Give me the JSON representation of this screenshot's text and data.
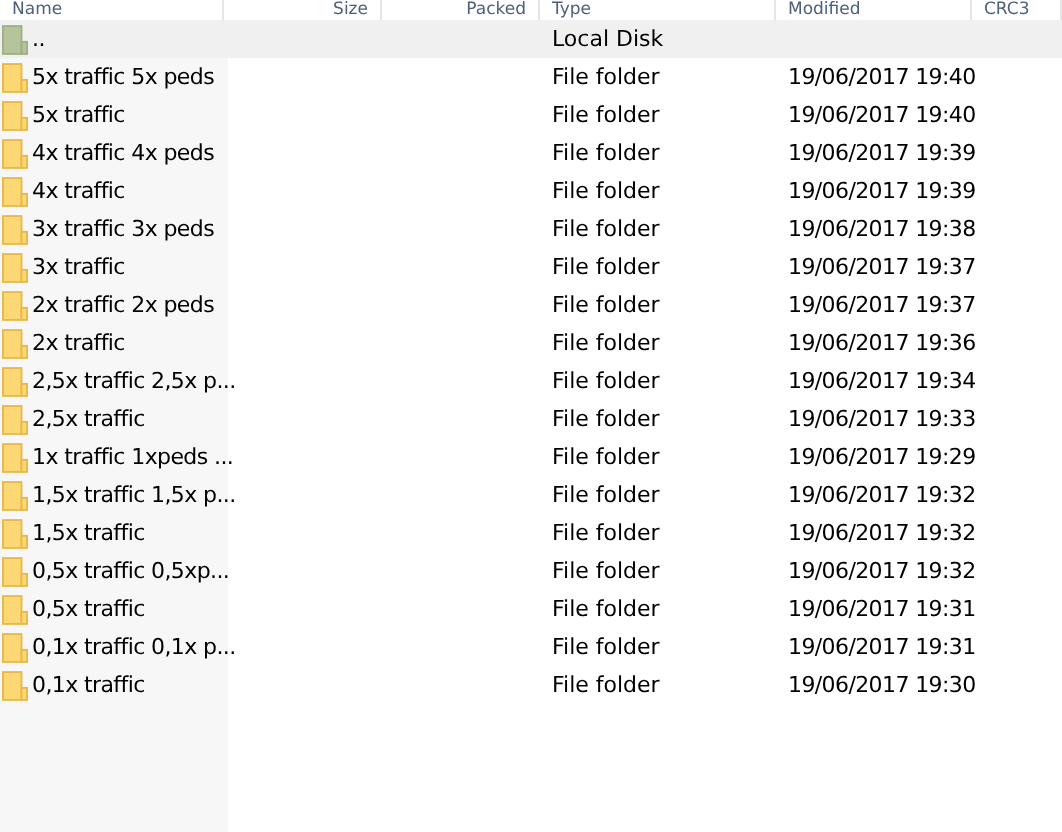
{
  "table": {
    "columns": [
      "Name",
      "Size",
      "Packed",
      "Type",
      "Modified",
      "CRC3"
    ],
    "rows": [
      {
        "kind": "parent",
        "name": "..",
        "type": "Local Disk",
        "modified": "",
        "selected": true
      },
      {
        "kind": "folder",
        "name": "5x traffic 5x peds",
        "type": "File folder",
        "modified": "19/06/2017 19:40",
        "selected": false
      },
      {
        "kind": "folder",
        "name": "5x traffic",
        "type": "File folder",
        "modified": "19/06/2017 19:40",
        "selected": false
      },
      {
        "kind": "folder",
        "name": "4x traffic 4x peds",
        "type": "File folder",
        "modified": "19/06/2017 19:39",
        "selected": false
      },
      {
        "kind": "folder",
        "name": "4x traffic",
        "type": "File folder",
        "modified": "19/06/2017 19:39",
        "selected": false
      },
      {
        "kind": "folder",
        "name": "3x traffic 3x peds",
        "type": "File folder",
        "modified": "19/06/2017 19:38",
        "selected": false
      },
      {
        "kind": "folder",
        "name": "3x traffic",
        "type": "File folder",
        "modified": "19/06/2017 19:37",
        "selected": false
      },
      {
        "kind": "folder",
        "name": "2x traffic 2x peds",
        "type": "File folder",
        "modified": "19/06/2017 19:37",
        "selected": false
      },
      {
        "kind": "folder",
        "name": "2x traffic",
        "type": "File folder",
        "modified": "19/06/2017 19:36",
        "selected": false
      },
      {
        "kind": "folder",
        "name": "2,5x traffic 2,5x p...",
        "type": "File folder",
        "modified": "19/06/2017 19:34",
        "selected": false
      },
      {
        "kind": "folder",
        "name": "2,5x traffic",
        "type": "File folder",
        "modified": "19/06/2017 19:33",
        "selected": false
      },
      {
        "kind": "folder",
        "name": "1x traffic 1xpeds ...",
        "type": "File folder",
        "modified": "19/06/2017 19:29",
        "selected": false
      },
      {
        "kind": "folder",
        "name": "1,5x traffic 1,5x p...",
        "type": "File folder",
        "modified": "19/06/2017 19:32",
        "selected": false
      },
      {
        "kind": "folder",
        "name": "1,5x traffic",
        "type": "File folder",
        "modified": "19/06/2017 19:32",
        "selected": false
      },
      {
        "kind": "folder",
        "name": "0,5x traffic 0,5xp...",
        "type": "File folder",
        "modified": "19/06/2017 19:32",
        "selected": false
      },
      {
        "kind": "folder",
        "name": "0,5x traffic",
        "type": "File folder",
        "modified": "19/06/2017 19:31",
        "selected": false
      },
      {
        "kind": "folder",
        "name": "0,1x traffic 0,1x p...",
        "type": "File folder",
        "modified": "19/06/2017 19:31",
        "selected": false
      },
      {
        "kind": "folder",
        "name": "0,1x traffic",
        "type": "File folder",
        "modified": "19/06/2017 19:30",
        "selected": false
      }
    ]
  }
}
